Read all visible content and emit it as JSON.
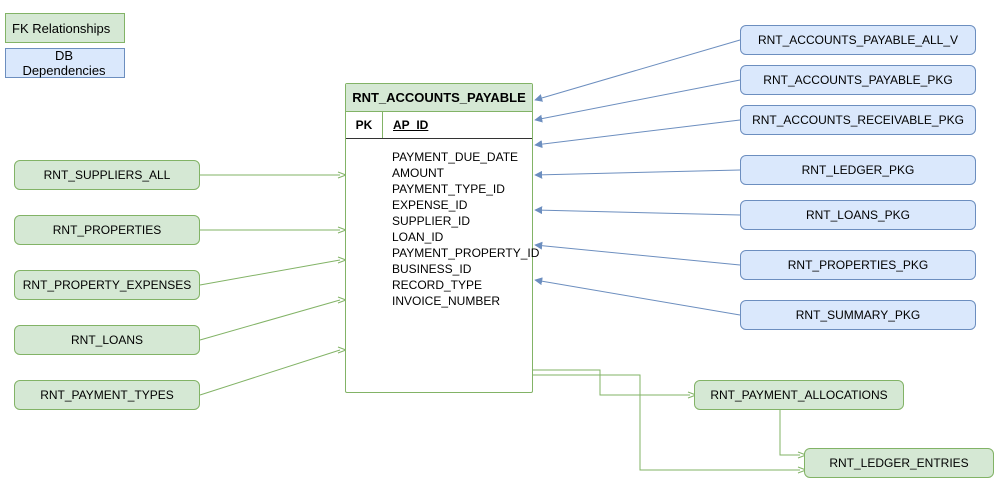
{
  "legend": {
    "fk": "FK Relationships",
    "db": "DB Dependencies"
  },
  "entity": {
    "title": "RNT_ACCOUNTS_PAYABLE",
    "pk_label": "PK",
    "pk_field": "AP_ID",
    "columns": "PAYMENT_DUE_DATE\nAMOUNT\nPAYMENT_TYPE_ID\nEXPENSE_ID\nSUPPLIER_ID\nLOAN_ID\nPAYMENT_PROPERTY_ID\nBUSINESS_ID\nRECORD_TYPE\nINVOICE_NUMBER"
  },
  "fk_left": [
    "RNT_SUPPLIERS_ALL",
    "RNT_PROPERTIES",
    "RNT_PROPERTY_EXPENSES",
    "RNT_LOANS",
    "RNT_PAYMENT_TYPES"
  ],
  "fk_right": [
    "RNT_PAYMENT_ALLOCATIONS",
    "RNT_LEDGER_ENTRIES"
  ],
  "db_right": [
    "RNT_ACCOUNTS_PAYABLE_ALL_V",
    "RNT_ACCOUNTS_PAYABLE_PKG",
    "RNT_ACCOUNTS_RECEIVABLE_PKG",
    "RNT_LEDGER_PKG",
    "RNT_LOANS_PKG",
    "RNT_PROPERTIES_PKG",
    "RNT_SUMMARY_PKG"
  ]
}
